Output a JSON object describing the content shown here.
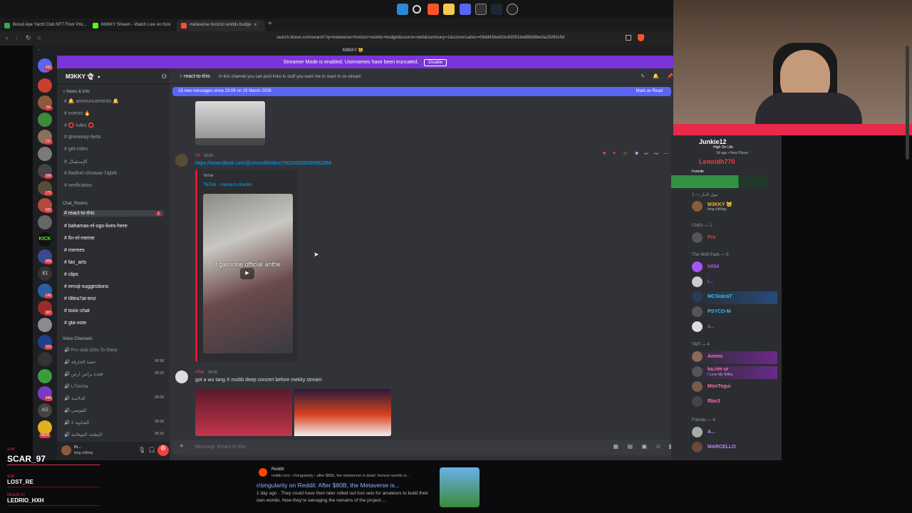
{
  "browser": {
    "tabs": [
      {
        "title": "Bored Ape Yacht Club NFT Floor Pric...",
        "color": "#2fa84f"
      },
      {
        "title": "M3KKY Stream - Watch Live on Kick",
        "color": "#53fc18"
      },
      {
        "title": "metaverse horizon worlds budge",
        "color": "#ff4f2a"
      }
    ],
    "url": "search.brave.com/search?q=metaverse+horizon+worlds+budget&source=web&summary=1&conversation=08dd42bed1bc63001be88b58be0a19263c5d"
  },
  "discord": {
    "window_title": "M3KKY 🐱",
    "streamer_banner": "Streamer Mode is enabled. Usernames have been truncated.",
    "streamer_button": "Disable",
    "server_name": "M3KKY 👻",
    "server_badges": [
      "452",
      "64",
      "237",
      "106",
      "172",
      "922",
      "5",
      "309",
      "96",
      "143",
      "307",
      "116",
      "183",
      "449",
      "NEW"
    ],
    "categories": {
      "news": "News & Info",
      "chat": "Chat_Rooms",
      "voice": "Voice Channels"
    },
    "news_channels": [
      "🔔 announcements 🔔",
      "events 🔥",
      "⭕ rules ⭕",
      "giveaway-beta",
      "get-roles",
      "الإستقبال",
      "tfadhel-chnowa-7ajtek",
      "verification"
    ],
    "chat_channels": [
      "react-to-this",
      "bahamas-el-ogs-lives-here",
      "fin-el-meme",
      "memes",
      "fan_arts",
      "clips",
      "emoji-suggestions",
      "i9tira7at-test",
      "toxic-chat",
      "gta-vote"
    ],
    "active_badge": "1",
    "voice_channels": [
      {
        "name": "Pro club OGs To Glory",
        "count": ""
      },
      {
        "name": "حصة الحارقة",
        "count": "00 99"
      },
      {
        "name": "قعدة براس ارض",
        "count": "00 02"
      },
      {
        "name": "L7ouma",
        "count": ""
      },
      {
        "name": "الدلاسة",
        "count": "00 05"
      },
      {
        "name": "الفوضى",
        "count": ""
      },
      {
        "name": "2 الشاوية",
        "count": "00 05"
      },
      {
        "name": "البطحة الفوقانية",
        "count": "00 10"
      }
    ],
    "user": {
      "name": "m...",
      "status": "bing chilling"
    },
    "chat": {
      "channel": "react-to-this",
      "topic": "In this channel you can post links to stuff you want me to react to on stream",
      "new_messages": "18 new messages since 23:08 on 19 March 2026",
      "mark_read": "Mark as Read",
      "msg1": {
        "author": "59",
        "time": "00:25",
        "link": "https://www.tiktok.com/@shmndl/video/760200566359962996",
        "embed_provider": "TikTok",
        "embed_title": "TikTok · moslem.chebbi",
        "video_caption": "I gassrine official anthe"
      },
      "msg2": {
        "author": "H5M",
        "time": "00:25",
        "text": "got a wu tang X mobb deep concert before mekky stream"
      },
      "input_placeholder": "Message #react-to-this"
    },
    "members": {
      "top": [
        {
          "name": "Junkie12",
          "sub": "High On Life",
          "extra": "2d ago • New Player"
        },
        {
          "name": "Lemridh770",
          "sub": "Fortnite"
        }
      ],
      "groups": [
        {
          "title": "مول الدار — 1",
          "members": [
            {
              "name": "M3KKY 🐱",
              "sub": "bing chilling",
              "color": "#f0b232"
            }
          ]
        },
        {
          "title": "Chill's — 1",
          "members": [
            {
              "name": "Fro",
              "color": "#f23f43"
            }
          ]
        },
        {
          "title": "The Wolf Pack — 5",
          "members": [
            {
              "name": "h00d",
              "color": "#a855f7"
            },
            {
              "name": "i...",
              "color": "#a855f7"
            },
            {
              "name": "MCSokraT",
              "color": "#38bdf8"
            },
            {
              "name": "PSYCO-M",
              "color": "#38bdf8"
            },
            {
              "name": "s...",
              "color": "#a855f7"
            }
          ]
        },
        {
          "title": "TMT — 4",
          "members": [
            {
              "name": "Amine",
              "color": "#f472b6"
            },
            {
              "name": "ka.rim ur",
              "sub": "I Love My Wifey",
              "color": "#f472b6"
            },
            {
              "name": "MonTegui",
              "color": "#f472b6"
            },
            {
              "name": "Rbo3",
              "color": "#f472b6"
            }
          ]
        },
        {
          "title": "Friends — 4",
          "members": [
            {
              "name": "A...",
              "color": "#c084fc"
            },
            {
              "name": "MARCELLO",
              "color": "#c084fc"
            }
          ]
        }
      ]
    }
  },
  "overlay": {
    "reddit_source": "Reddit",
    "reddit_url": "reddit.com › r/singularity › after $80b, the metaverse is dead. horizon worlds is...",
    "reddit_title": "r/singularity on Reddit: After $80B, the Metaverse is...",
    "reddit_snippet": "1 day ago · They could have then later rolled out tool sets for amateurs to build their own worlds. Now they're salvaging the remains of the project ...",
    "subs": [
      {
        "label": "SUB",
        "name": "SCAR_97"
      },
      {
        "label": "SUB",
        "name": "LOST_RE"
      },
      {
        "label": "RESUB X3",
        "name": "LEDRIO_HXH"
      }
    ]
  }
}
